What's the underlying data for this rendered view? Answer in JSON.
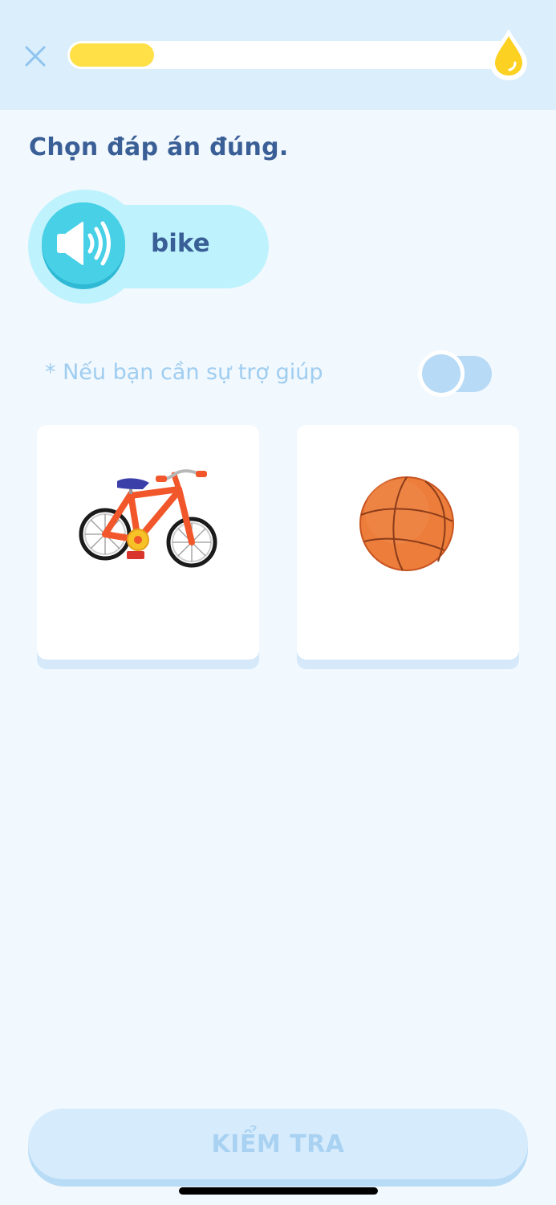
{
  "header": {
    "close_icon": "close-icon",
    "progress_fraction": 0.19,
    "progress_color": "#ffe047",
    "badge_icon": "drop-icon"
  },
  "question": {
    "title": "Chọn đáp án đúng."
  },
  "audio": {
    "icon": "speaker-icon",
    "word": "bike",
    "accent": "#48d0e6"
  },
  "help": {
    "text": "* Nếu bạn cần sự trợ giúp",
    "toggle_on": false
  },
  "options": [
    {
      "image": "bicycle-image"
    },
    {
      "image": "basketball-image"
    }
  ],
  "footer": {
    "check_label": "KIỂM TRA",
    "enabled": false
  }
}
